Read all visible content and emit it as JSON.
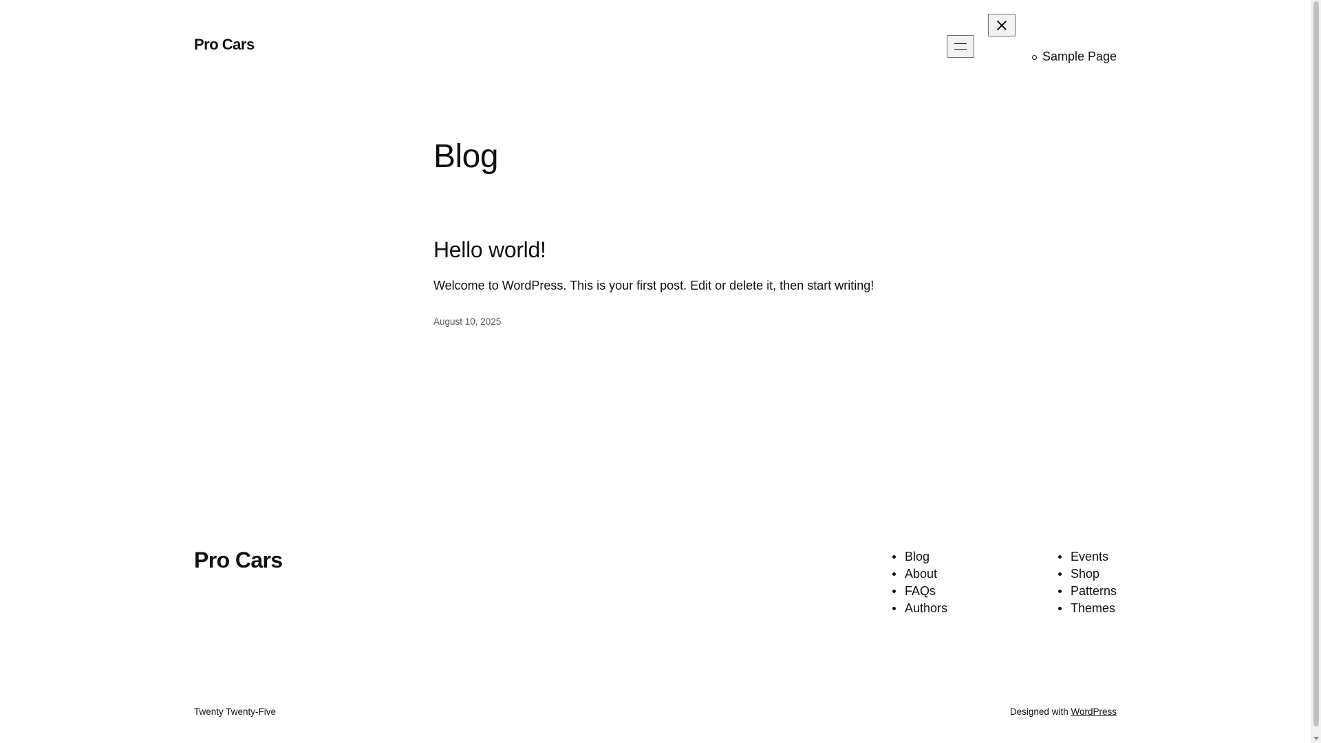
{
  "header": {
    "site_title": "Pro Cars",
    "nav_items": [
      {
        "label": "Sample Page"
      }
    ]
  },
  "main": {
    "page_heading": "Blog",
    "posts": [
      {
        "title": "Hello world!",
        "excerpt": "Welcome to WordPress. This is your first post. Edit or delete it, then start writing!",
        "date": "August 10, 2025"
      }
    ]
  },
  "footer": {
    "site_title": "Pro Cars",
    "nav_col1": [
      "Blog",
      "About",
      "FAQs",
      "Authors"
    ],
    "nav_col2": [
      "Events",
      "Shop",
      "Patterns",
      "Themes"
    ],
    "theme_credit": "Twenty Twenty-Five",
    "designed_with_text": "Designed with",
    "designed_with_link": "WordPress"
  },
  "icons": {
    "open_menu": "hamburger-icon",
    "close_menu": "close-icon"
  }
}
